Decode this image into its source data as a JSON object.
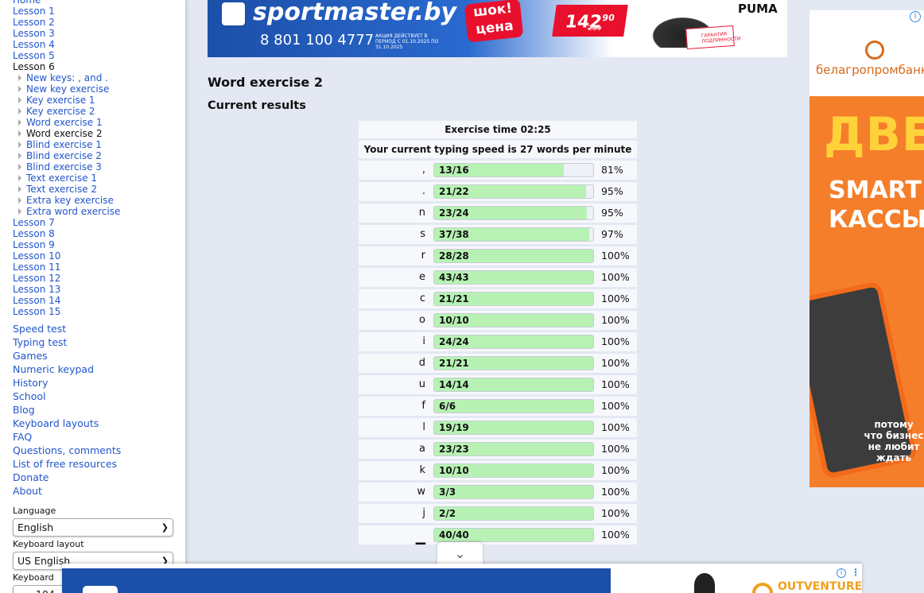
{
  "sidebar": {
    "lessons_before": [
      "Home",
      "Lesson 1",
      "Lesson 2",
      "Lesson 3",
      "Lesson 4",
      "Lesson 5"
    ],
    "current_lesson": "Lesson 6",
    "sub_items": [
      "New keys: , and .",
      "New key exercise",
      "Key exercise 1",
      "Key exercise 2",
      "Word exercise 1",
      "Word exercise 2",
      "Blind exercise 1",
      "Blind exercise 2",
      "Blind exercise 3",
      "Text exercise 1",
      "Text exercise 2",
      "Extra key exercise",
      "Extra word exercise"
    ],
    "current_sub_index": 5,
    "lessons_after": [
      "Lesson 7",
      "Lesson 8",
      "Lesson 9",
      "Lesson 10",
      "Lesson 11",
      "Lesson 12",
      "Lesson 13",
      "Lesson 14",
      "Lesson 15"
    ],
    "main_links": [
      "Speed test",
      "Typing test",
      "Games",
      "Numeric keypad",
      "History",
      "School",
      "Blog",
      "Keyboard layouts",
      "FAQ",
      "Questions, comments",
      "List of free resources",
      "Donate",
      "About"
    ],
    "language_label": "Language",
    "language_value": "English",
    "layout_label": "Keyboard layout",
    "layout_value": "US English",
    "keyboard_label": "Keyboard",
    "keyboard_value": "104"
  },
  "top_ad": {
    "brand": "sportmaster.by",
    "phone": "8 801 100 4777",
    "fine_print": "АКЦИЯ ДЕЙСТВУЕТ В ПЕРИОД С 01.10.2025 ПО 31.10.2025",
    "badge": "шок! цена",
    "price_main": "142",
    "price_cents": "90",
    "old_price": "259",
    "guarantee": "ГАРАНТИЯ ПОДЛИННОСТИ",
    "puma": "PUMA"
  },
  "exercise": {
    "title": "Word exercise 2",
    "results_heading": "Current results",
    "time_text": "Exercise time 02:25",
    "speed_text": "Your current typing speed is 27 words per minute"
  },
  "results": [
    {
      "key": ",",
      "label": "13/16",
      "fraction": 0.8125,
      "pct": "81%"
    },
    {
      "key": ".",
      "label": "21/22",
      "fraction": 0.9545,
      "pct": "95%"
    },
    {
      "key": "n",
      "label": "23/24",
      "fraction": 0.9583,
      "pct": "95%"
    },
    {
      "key": "s",
      "label": "37/38",
      "fraction": 0.9737,
      "pct": "97%"
    },
    {
      "key": "r",
      "label": "28/28",
      "fraction": 1,
      "pct": "100%"
    },
    {
      "key": "e",
      "label": "43/43",
      "fraction": 1,
      "pct": "100%"
    },
    {
      "key": "c",
      "label": "21/21",
      "fraction": 1,
      "pct": "100%"
    },
    {
      "key": "o",
      "label": "10/10",
      "fraction": 1,
      "pct": "100%"
    },
    {
      "key": "i",
      "label": "24/24",
      "fraction": 1,
      "pct": "100%"
    },
    {
      "key": "d",
      "label": "21/21",
      "fraction": 1,
      "pct": "100%"
    },
    {
      "key": "u",
      "label": "14/14",
      "fraction": 1,
      "pct": "100%"
    },
    {
      "key": "f",
      "label": "6/6",
      "fraction": 1,
      "pct": "100%"
    },
    {
      "key": "l",
      "label": "19/19",
      "fraction": 1,
      "pct": "100%"
    },
    {
      "key": "a",
      "label": "23/23",
      "fraction": 1,
      "pct": "100%"
    },
    {
      "key": "k",
      "label": "10/10",
      "fraction": 1,
      "pct": "100%"
    },
    {
      "key": "w",
      "label": "3/3",
      "fraction": 1,
      "pct": "100%"
    },
    {
      "key": "j",
      "label": "2/2",
      "fraction": 1,
      "pct": "100%"
    },
    {
      "key": "▁",
      "label": "40/40",
      "fraction": 1,
      "pct": "100%"
    }
  ],
  "side_ad": {
    "bank": "белагропромбанк",
    "headline": "ДВЕ",
    "subhead_1": "SMART",
    "subhead_2": "КАССЫ",
    "tagline": "потому что бизнес не любит ждать",
    "info_icon": "info-icon"
  },
  "bottom_ad": {
    "brand": "OUTVENTURE",
    "collapse_icon": "chevron-down-icon"
  },
  "colors": {
    "page_bg": "#e4e8f3",
    "link": "#2255cc",
    "bar_fill": "#b7f2b4",
    "ad_orange": "#f57e2a",
    "ad_blue": "#1c4fa8"
  }
}
